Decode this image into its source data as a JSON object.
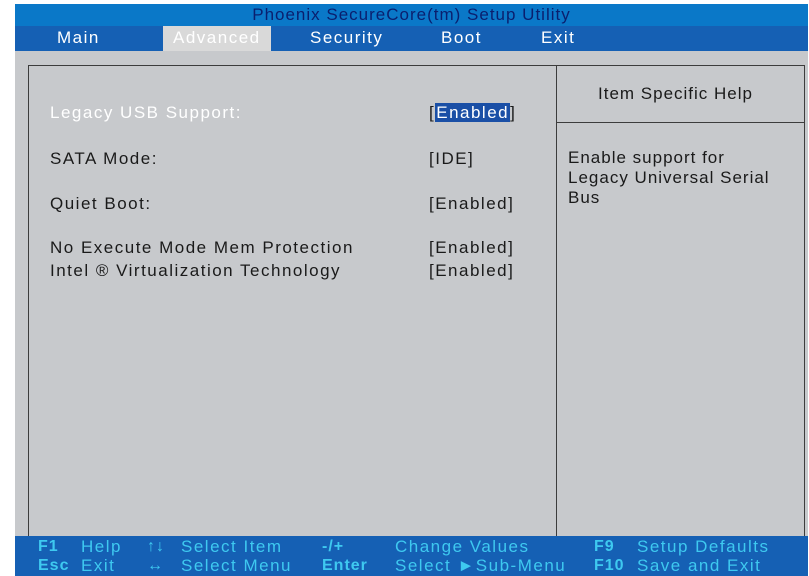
{
  "title": "Phoenix SecureCore(tm) Setup Utility",
  "menu": {
    "items": [
      {
        "label": "Main"
      },
      {
        "label": "Advanced"
      },
      {
        "label": "Security"
      },
      {
        "label": "Boot"
      },
      {
        "label": "Exit"
      }
    ],
    "active": "Advanced"
  },
  "settings": [
    {
      "label": "Legacy USB Support:",
      "value_open": "[",
      "value": "Enabled",
      "value_close": "]",
      "selected": true
    },
    {
      "label": "SATA Mode:",
      "value": "[IDE]"
    },
    {
      "label": "Quiet Boot:",
      "value": "[Enabled]"
    },
    {
      "label": "No Execute Mode Mem Protection",
      "value": "[Enabled]"
    },
    {
      "label": "Intel ® Virtualization Technology",
      "value": "[Enabled]"
    }
  ],
  "help": {
    "title": "Item Specific Help",
    "text": "Enable support for\nLegacy Universal Serial\nBus"
  },
  "footer": {
    "row1": [
      {
        "key": "F1",
        "desc": "Help"
      },
      {
        "key": "↑↓",
        "desc": "Select Item"
      },
      {
        "key": "-/+",
        "desc": "Change Values"
      },
      {
        "key": "F9",
        "desc": "Setup Defaults"
      }
    ],
    "row2": [
      {
        "key": "Esc",
        "desc": "Exit"
      },
      {
        "key": "↔",
        "desc": "Select Menu"
      },
      {
        "key": "Enter",
        "desc": "Select ►Sub-Menu"
      },
      {
        "key": "F10",
        "desc": "Save and Exit"
      }
    ]
  },
  "colors": {
    "title_bg": "#0a78c8",
    "menu_bg": "#1560b4",
    "panel_bg": "#c7c9cc",
    "key_text": "#3ec9f0",
    "highlight": "#1a4fa6"
  }
}
